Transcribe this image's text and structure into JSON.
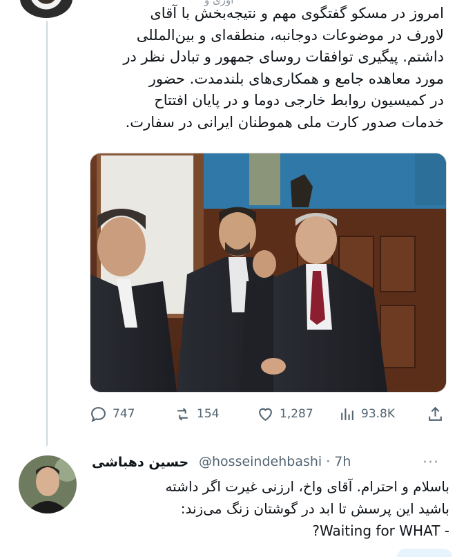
{
  "top_tweet": {
    "text": "امروز در مسکو گفتگوی مهم و نتیجه‌بخش با آقای\nلاورف در موضوعات دوجانبه، منطقه‌ای و بین‌المللی\nداشتم. پیگیری توافقات روسای جمهور و تبادل نظر در\nمورد معاهده جامع و همکاری‌های بلندمدت. حضور\nدر کمیسیون روابط خارجی دوما و در پایان افتتاح\nخدمات صدور کارت ملی هموطنان ایرانی در سفارت.",
    "header_cut": "اوری و",
    "stats": {
      "replies": "747",
      "retweets": "154",
      "likes": "1,287",
      "views": "93.8K"
    },
    "icons": [
      "reply-icon",
      "retweet-icon",
      "like-icon",
      "views-icon",
      "share-icon"
    ]
  },
  "reply_tweet": {
    "name": "حسین دهباشی",
    "handle": "@hosseindehbashi · 7h",
    "more": "···",
    "text": "باسلام و احترام. آقای واخ، ارزنی غیرت اگر داشته\nباشید این پرسش تا ابد در گوشتان زنگ می‌زند:\n- Waiting for WHAT?"
  },
  "colors": {
    "text": "#0f1419",
    "secondary": "#536471",
    "thread_line": "#cfd9de"
  }
}
